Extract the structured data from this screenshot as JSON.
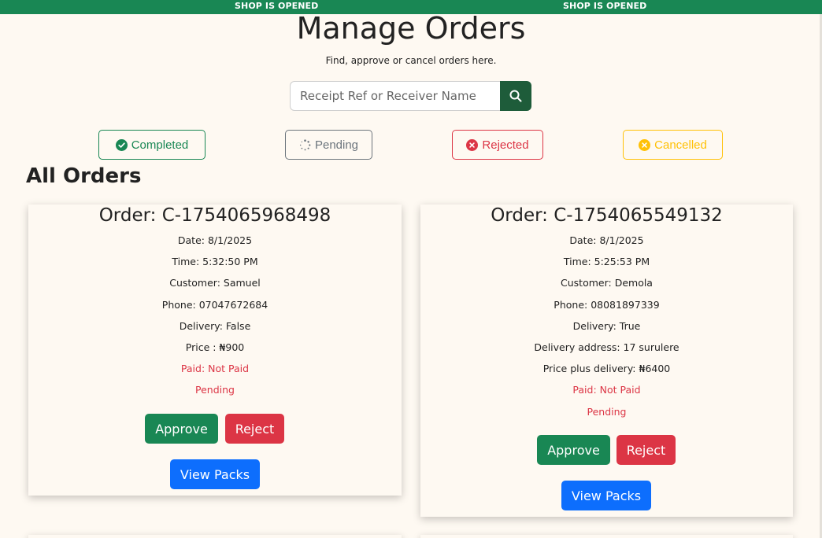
{
  "banner": {
    "text_1": "SHOP IS OPENED",
    "text_2": "SHOP IS OPENED",
    "color": "#198754"
  },
  "header": {
    "title": "Manage Orders",
    "subtitle": "Find, approve or cancel orders here."
  },
  "search": {
    "placeholder": "Receipt Ref or Receiver Name",
    "value": "",
    "button_icon": "search-icon"
  },
  "filters": [
    {
      "label": "Completed",
      "icon": "check-circle-icon",
      "color": "#198754"
    },
    {
      "label": "Pending",
      "icon": "spinner-icon",
      "color": "#6c757d"
    },
    {
      "label": "Rejected",
      "icon": "x-circle-icon",
      "color": "#dc3545"
    },
    {
      "label": "Cancelled",
      "icon": "x-circle-icon",
      "color": "#ffc107"
    }
  ],
  "section_title": "All Orders",
  "orders": [
    {
      "title": "Order: C-1754065968498",
      "date": "Date: 8/1/2025",
      "time": "Time: 5:32:50 PM",
      "customer": "Customer: Samuel",
      "phone": "Phone: 07047672684",
      "delivery": "Delivery: False",
      "price": "Price : ₦900",
      "paid": "Paid: Not Paid",
      "status": "Pending",
      "approve_label": "Approve",
      "reject_label": "Reject",
      "packs_label": "View Packs"
    },
    {
      "title": "Order: C-1754065549132",
      "date": "Date: 8/1/2025",
      "time": "Time: 5:25:53 PM",
      "customer": "Customer: Demola",
      "phone": "Phone: 08081897339",
      "delivery": "Delivery: True",
      "address": "Delivery address: 17 surulere",
      "price": "Price plus delivery: ₦6400",
      "paid": "Paid: Not Paid",
      "status": "Pending",
      "approve_label": "Approve",
      "reject_label": "Reject",
      "packs_label": "View Packs"
    }
  ],
  "colors": {
    "success": "#198754",
    "danger": "#dc3545",
    "primary": "#0d6efd",
    "warning": "#ffc107",
    "secondary": "#6c757d",
    "background": "#fef9f2"
  }
}
